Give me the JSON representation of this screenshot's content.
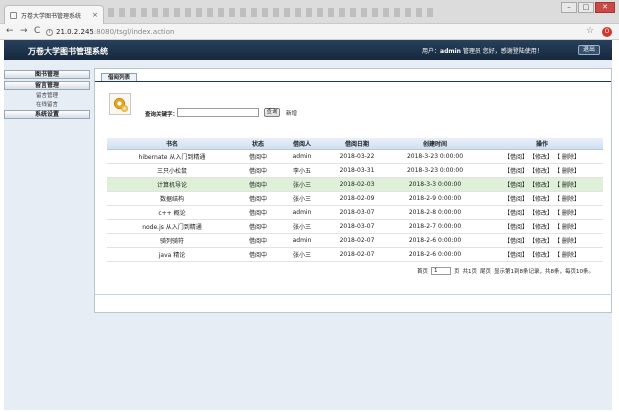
{
  "browser": {
    "tab_title": "万卷大学图书管理系统",
    "tab_close": "×",
    "win_min": "–",
    "win_max": "□",
    "win_close": "✕",
    "back": "←",
    "forward": "→",
    "reload": "C",
    "url_host": "21.0.2.245",
    "url_path": ":8080/tsgl/index.action",
    "star": "☆"
  },
  "header": {
    "system_title": "万卷大学图书管理系统",
    "user_prefix": "用户：",
    "user_name": "admin",
    "user_suffix": " 管理员 您好，感谢登陆使用！",
    "logout_label": "退出"
  },
  "sidebar": {
    "book_mgmt": "图书管理",
    "msg_mgmt": "留言管理",
    "sub_items": [
      "留言管理",
      "在线留言"
    ],
    "sys_settings": "系统设置"
  },
  "panel": {
    "tab_label": "借阅列表",
    "search_label": "查询关键字：",
    "search_value": "",
    "search_button": "查询",
    "new_button": "新增"
  },
  "table": {
    "columns": [
      "书名",
      "状态",
      "借阅人",
      "借阅日期",
      "创建时间",
      "操作"
    ],
    "ops": [
      "【借阅】",
      "【修改】",
      "【 删除】"
    ],
    "rows": [
      [
        "hibernate 从入门到精通",
        "借阅中",
        "admin",
        "2018-03-22",
        "2018-3-23 0:00:00"
      ],
      [
        "三只小松鼠",
        "借阅中",
        "李小五",
        "2018-03-31",
        "2018-3-23 0:00:00"
      ],
      [
        "计算机导论",
        "借阅中",
        "张小三",
        "2018-02-03",
        "2018-3-3 0:00:00"
      ],
      [
        "数据结构",
        "借阅中",
        "张小三",
        "2018-02-09",
        "2018-2-9 0:00:00"
      ],
      [
        "c++ 概论",
        "借阅中",
        "admin",
        "2018-03-07",
        "2018-2-8 0:00:00"
      ],
      [
        "node.js 从入门到精通",
        "借阅中",
        "张小三",
        "2018-03-07",
        "2018-2-7 0:00:00"
      ],
      [
        "骑列骑符",
        "借阅中",
        "admin",
        "2018-02-07",
        "2018-2-6 0:00:00"
      ],
      [
        "java 精论",
        "借阅中",
        "张小三",
        "2018-02-07",
        "2018-2-6 0:00:00"
      ]
    ]
  },
  "pager": {
    "first": "首页",
    "page_value": "1",
    "page_unit": "页",
    "total_pages": "共1页",
    "last": "尾页",
    "summary": "显示第1到8条记录，共8条，每页10条。"
  }
}
